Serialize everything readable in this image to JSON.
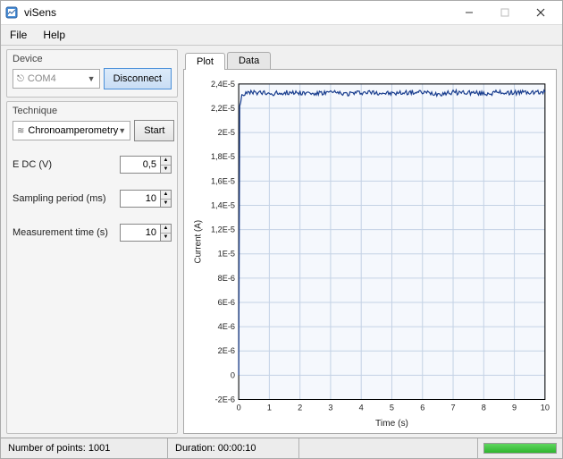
{
  "window": {
    "title": "viSens"
  },
  "menu": {
    "file": "File",
    "help": "Help"
  },
  "device": {
    "group_label": "Device",
    "port": "COM4",
    "disconnect_label": "Disconnect"
  },
  "technique": {
    "group_label": "Technique",
    "selected": "Chronoamperometry",
    "start_label": "Start",
    "params": {
      "edc_label": "E DC (V)",
      "edc_value": "0,5",
      "sampling_label": "Sampling period (ms)",
      "sampling_value": "10",
      "meastime_label": "Measurement time (s)",
      "meastime_value": "10"
    }
  },
  "tabs": {
    "plot": "Plot",
    "data": "Data"
  },
  "status": {
    "points_label": "Number of points:",
    "points_value": "1001",
    "duration_label": "Duration:",
    "duration_value": "00:00:10"
  },
  "chart_data": {
    "type": "line",
    "title": "",
    "xlabel": "Time (s)",
    "ylabel": "Current (A)",
    "xlim": [
      0,
      10
    ],
    "ylim": [
      -2e-06,
      2.4e-05
    ],
    "x_ticks": [
      0,
      1,
      2,
      3,
      4,
      5,
      6,
      7,
      8,
      9,
      10
    ],
    "y_ticks": [
      -2e-06,
      0,
      2e-06,
      4e-06,
      6e-06,
      8e-06,
      1e-05,
      1.2e-05,
      1.4e-05,
      1.6e-05,
      1.8e-05,
      2e-05,
      2.2e-05,
      2.4e-05
    ],
    "y_tick_labels": [
      "-2E-6",
      "0",
      "2E-6",
      "4E-6",
      "6E-6",
      "8E-6",
      "1E-5",
      "1,2E-5",
      "1,4E-5",
      "1,6E-5",
      "1,8E-5",
      "2E-5",
      "2,2E-5",
      "2,4E-5"
    ],
    "series": [
      {
        "name": "Current",
        "x": [
          0,
          0.02,
          0.1,
          0.2,
          0.5,
          1,
          1.5,
          2,
          2.5,
          3,
          3.5,
          4,
          4.5,
          5,
          5.5,
          6,
          6.5,
          7,
          7.5,
          8,
          8.5,
          9,
          9.5,
          10
        ],
        "y": [
          0,
          2.2e-05,
          2.31e-05,
          2.32e-05,
          2.33e-05,
          2.32e-05,
          2.33e-05,
          2.33e-05,
          2.32e-05,
          2.33e-05,
          2.32e-05,
          2.33e-05,
          2.33e-05,
          2.32e-05,
          2.33e-05,
          2.33e-05,
          2.32e-05,
          2.33e-05,
          2.33e-05,
          2.32e-05,
          2.33e-05,
          2.33e-05,
          2.33e-05,
          2.33e-05
        ],
        "noise": 2e-07
      }
    ]
  }
}
